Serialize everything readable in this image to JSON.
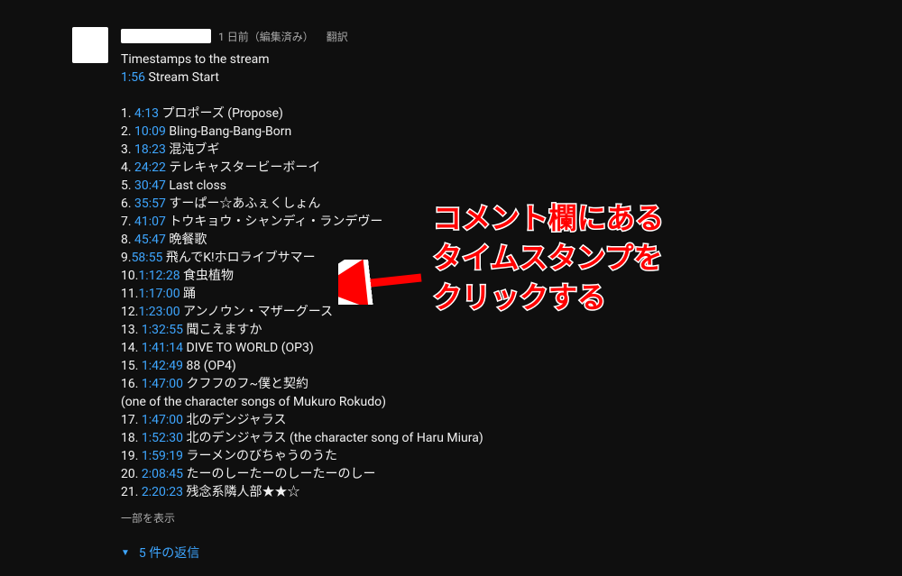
{
  "comment": {
    "meta": "1 日前（編集済み）",
    "translate": "翻訳",
    "intro": "Timestamps to the stream",
    "first_ts": "1:56",
    "first_label": "Stream Start",
    "items": [
      {
        "n": "1",
        "ts": "4:13",
        "label": "プロポーズ (Propose)"
      },
      {
        "n": "2",
        "ts": "10:09",
        "label": "Bling-Bang-Bang-Born"
      },
      {
        "n": "3",
        "ts": "18:23",
        "label": "混沌ブギ"
      },
      {
        "n": "4",
        "ts": "24:22",
        "label": "テレキャスタービーボーイ"
      },
      {
        "n": "5",
        "ts": "30:47",
        "label": "Last closs"
      },
      {
        "n": "6",
        "ts": "35:57",
        "label": "すーぱー☆あふぇくしょん"
      },
      {
        "n": "7",
        "ts": "41:07",
        "label": "トウキョウ・シャンディ・ランデヴー"
      },
      {
        "n": "8",
        "ts": "45:47",
        "label": "晩餐歌"
      },
      {
        "n": "9",
        "ts": "58:55",
        "label": "飛んでK!ホロライブサマー",
        "tight": true
      },
      {
        "n": "10",
        "ts": "1:12:28",
        "label": "食虫植物",
        "tight": true
      },
      {
        "n": "11",
        "ts": "1:17:00",
        "label": "踊",
        "tight": true
      },
      {
        "n": "12",
        "ts": "1:23:00",
        "label": "アンノウン・マザーグース",
        "tight": true
      },
      {
        "n": "13",
        "ts": "1:32:55",
        "label": "聞こえますか"
      },
      {
        "n": "14",
        "ts": "1:41:14",
        "label": "DIVE TO WORLD (OP3)"
      },
      {
        "n": "15",
        "ts": "1:42:49",
        "label": "88 (OP4)"
      },
      {
        "n": "16",
        "ts": "1:47:00",
        "label": "クフフのフ~僕と契約"
      }
    ],
    "note_line": "(one of the character songs of Mukuro Rokudo)",
    "items2": [
      {
        "n": "17",
        "ts": "1:47:00",
        "label": "北のデンジャラス"
      },
      {
        "n": "18",
        "ts": "1:52:30",
        "label": "北のデンジャラス (the character song of Haru Miura)"
      },
      {
        "n": "19",
        "ts": "1:59:19",
        "label": "ラーメンのびちゃうのうた"
      },
      {
        "n": "20",
        "ts": "2:08:45",
        "label": "たーのしーたーのしーたーのしー"
      },
      {
        "n": "21",
        "ts": "2:20:23",
        "label": "残念系隣人部★★☆"
      }
    ],
    "show_less": "一部を表示",
    "replies": "5 件の返信"
  },
  "annotation": {
    "line1": "コメント欄にある",
    "line2": "タイムスタンプを",
    "line3": "クリックする"
  }
}
